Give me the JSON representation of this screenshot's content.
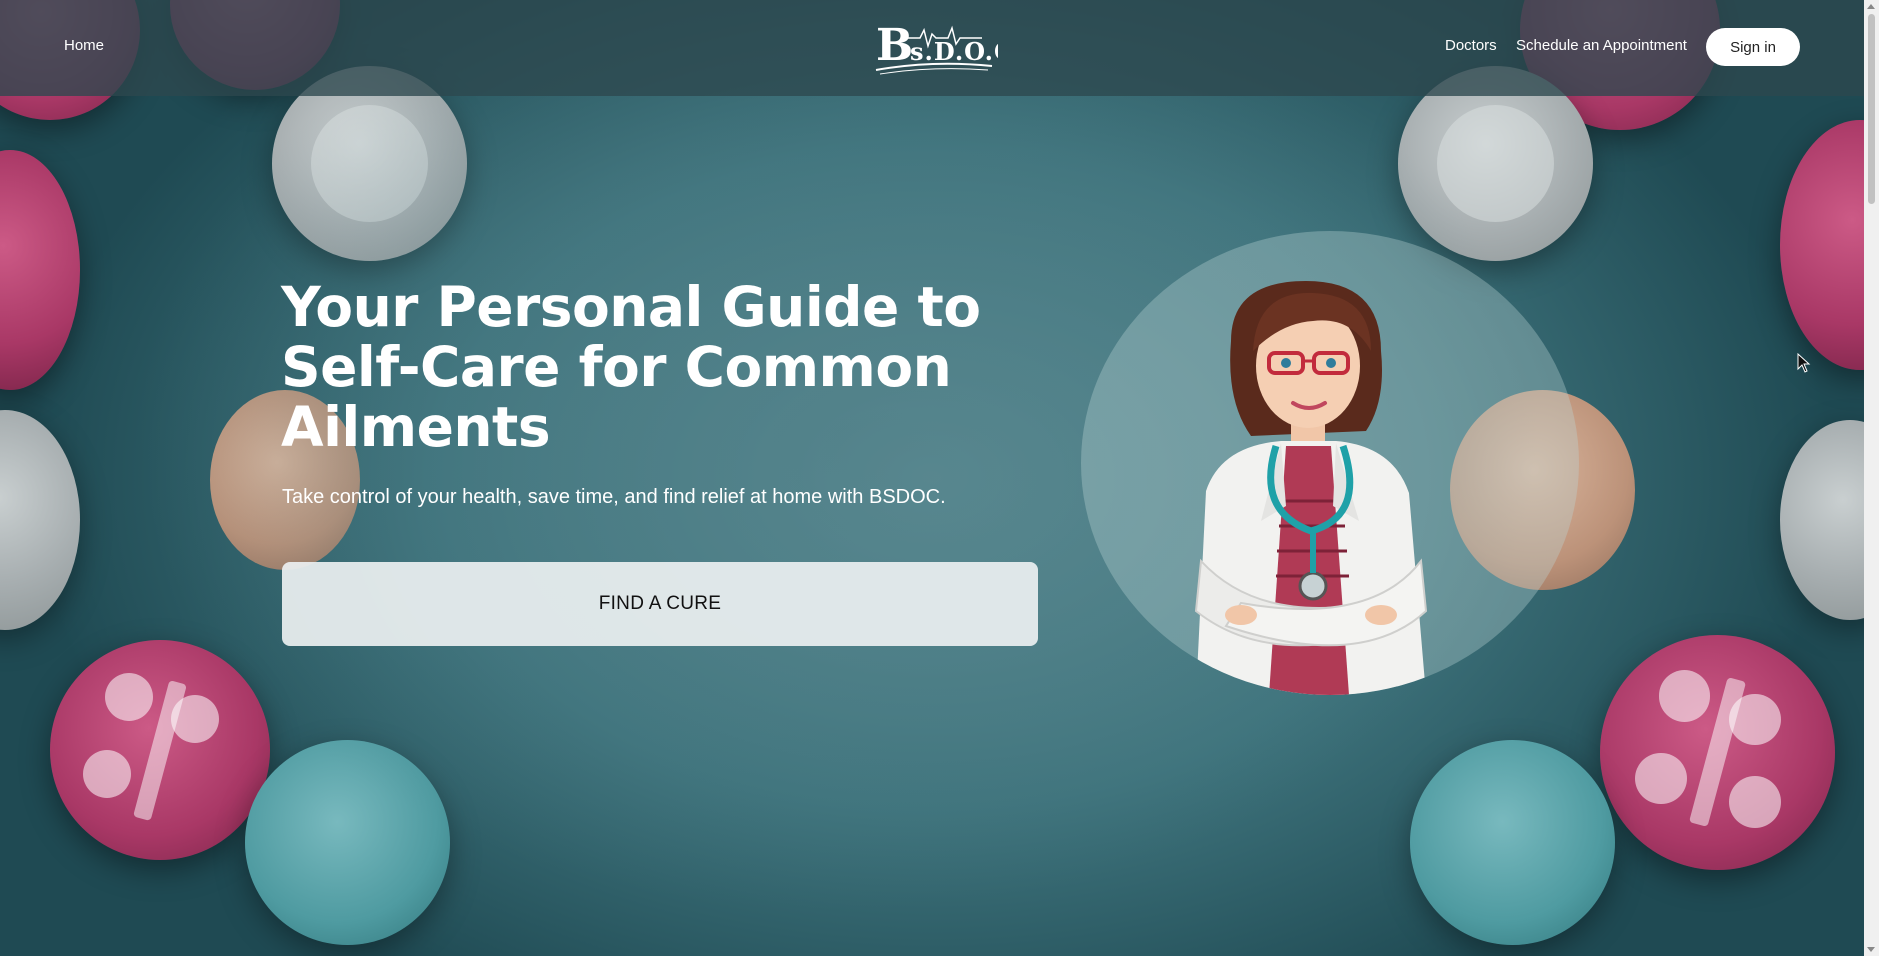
{
  "nav": {
    "home": "Home",
    "doctors": "Doctors",
    "schedule": "Schedule an Appointment",
    "sign_in": "Sign in",
    "logo_text": "Bs.D.O.C"
  },
  "hero": {
    "title_line1": "Your Personal Guide to",
    "title_line2": "Self-Care for Common",
    "title_line3": "Ailments",
    "subtitle": "Take control of your health, save time, and find relief at home with BSDOC.",
    "cta": "FIND A CURE"
  },
  "colors": {
    "topbar": "#2d484e",
    "background": "#4f8089",
    "cta_bg": "#ecf0f1",
    "signin_bg": "#ffffff"
  },
  "icons": {
    "illustration": "doctor-illustration",
    "cursor": "cursor-icon"
  }
}
